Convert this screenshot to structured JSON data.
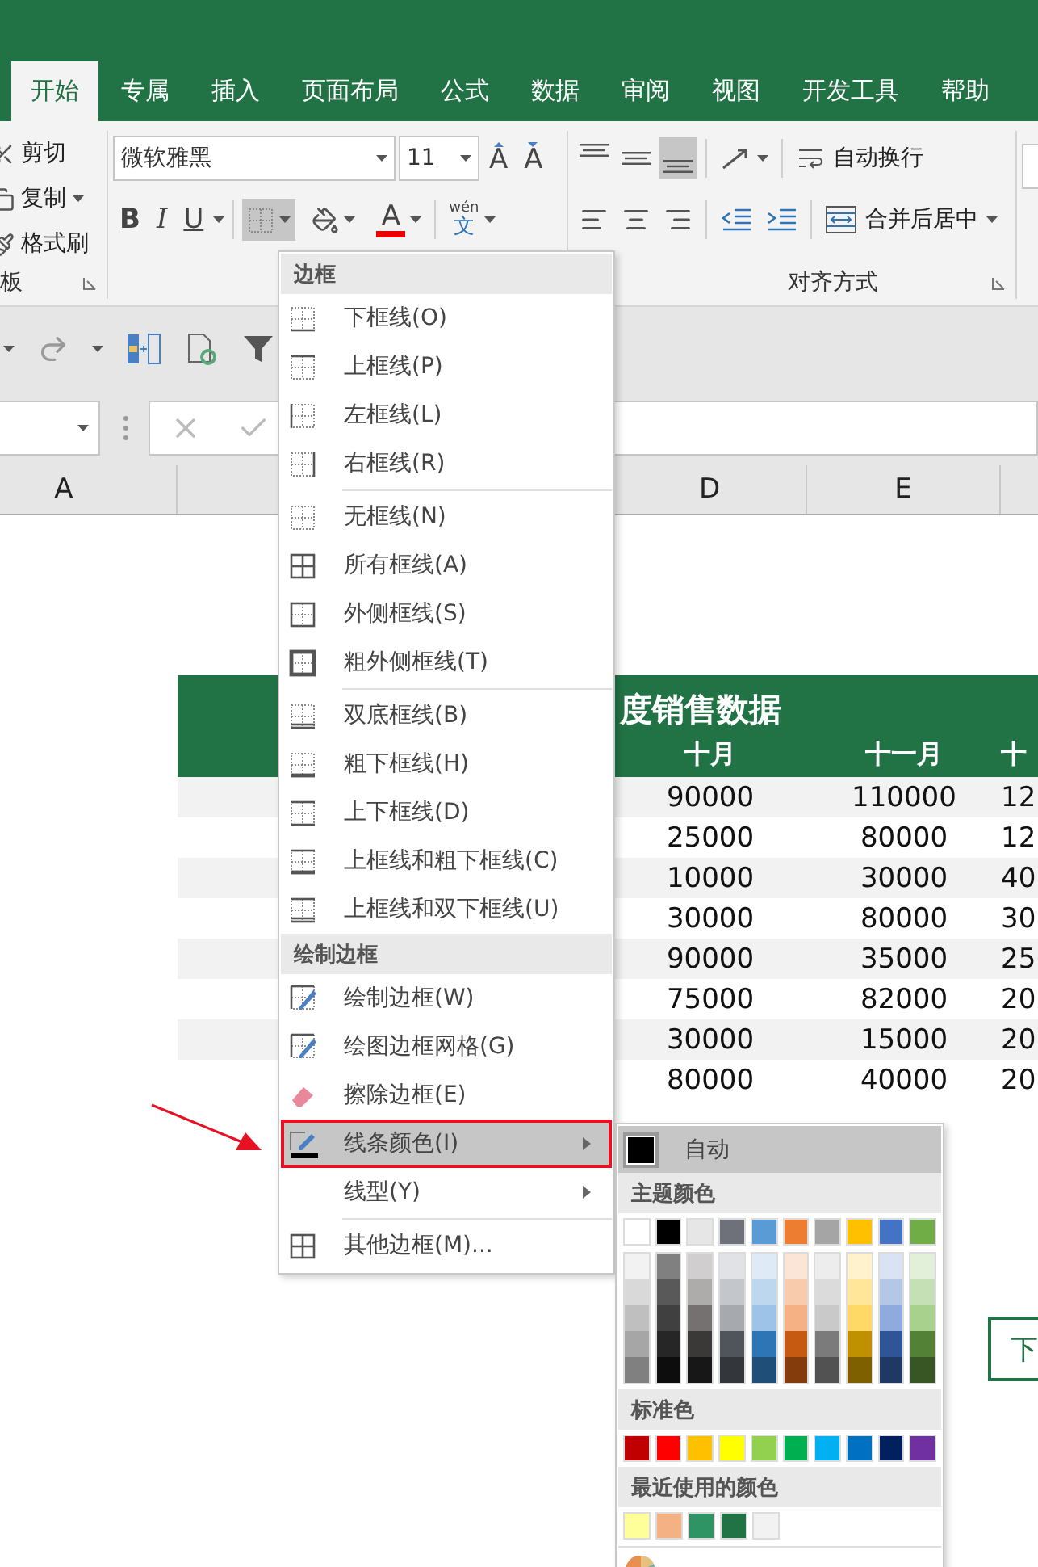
{
  "tabs": [
    {
      "label": "开始",
      "selected": true
    },
    {
      "label": "专属",
      "selected": false
    },
    {
      "label": "插入",
      "selected": false
    },
    {
      "label": "页面布局",
      "selected": false
    },
    {
      "label": "公式",
      "selected": false
    },
    {
      "label": "数据",
      "selected": false
    },
    {
      "label": "审阅",
      "selected": false
    },
    {
      "label": "视图",
      "selected": false
    },
    {
      "label": "开发工具",
      "selected": false
    },
    {
      "label": "帮助",
      "selected": false
    }
  ],
  "ribbon": {
    "clipboard": {
      "items": [
        {
          "label": "剪切",
          "has_menu": false
        },
        {
          "label": "复制",
          "has_menu": true
        },
        {
          "label": "格式刷",
          "has_menu": false
        }
      ],
      "group_label": "板"
    },
    "font": {
      "font_name": "微软雅黑",
      "font_size": "11",
      "grow_glyph": "A",
      "shrink_glyph": "A",
      "bold": "B",
      "italic": "I",
      "underline": "U",
      "border_pressed": true,
      "font_color_glyph": "A",
      "phonetic_top": "wén",
      "phonetic_bottom": "文"
    },
    "alignment": {
      "bottom_align_pressed": true,
      "wrap_text": "自动换行",
      "merge_center": "合并后居中",
      "group_label": "对齐方式"
    }
  },
  "column_headers": [
    {
      "label": "A"
    },
    {
      "label": "D"
    },
    {
      "label": "E"
    }
  ],
  "sheet": {
    "title": "度销售数据",
    "months": [
      "十月",
      "十一月",
      "十"
    ],
    "rows": [
      {
        "cells": [
          "90000",
          "110000",
          "12"
        ]
      },
      {
        "cells": [
          "25000",
          "80000",
          "12"
        ]
      },
      {
        "cells": [
          "10000",
          "30000",
          "40"
        ]
      },
      {
        "cells": [
          "30000",
          "80000",
          "30"
        ]
      },
      {
        "cells": [
          "90000",
          "35000",
          "25"
        ]
      },
      {
        "cells": [
          "75000",
          "82000",
          "20"
        ]
      },
      {
        "cells": [
          "30000",
          "15000",
          "20"
        ]
      },
      {
        "cells": [
          "80000",
          "40000",
          "20"
        ]
      }
    ]
  },
  "side_button": "下",
  "border_menu": {
    "sections": [
      {
        "heading": "边框",
        "groups": [
          [
            {
              "label": "下框线(O)",
              "selected": false,
              "highlighted": false,
              "submenu": false
            },
            {
              "label": "上框线(P)",
              "selected": false,
              "highlighted": false,
              "submenu": false
            },
            {
              "label": "左框线(L)",
              "selected": false,
              "highlighted": false,
              "submenu": false
            },
            {
              "label": "右框线(R)",
              "selected": false,
              "highlighted": false,
              "submenu": false
            }
          ],
          [
            {
              "label": "无框线(N)",
              "selected": false,
              "highlighted": false,
              "submenu": false
            },
            {
              "label": "所有框线(A)",
              "selected": false,
              "highlighted": false,
              "submenu": false
            },
            {
              "label": "外侧框线(S)",
              "selected": false,
              "highlighted": false,
              "submenu": false
            },
            {
              "label": "粗外侧框线(T)",
              "selected": false,
              "highlighted": false,
              "submenu": false
            }
          ],
          [
            {
              "label": "双底框线(B)",
              "selected": false,
              "highlighted": false,
              "submenu": false
            },
            {
              "label": "粗下框线(H)",
              "selected": false,
              "highlighted": false,
              "submenu": false
            },
            {
              "label": "上下框线(D)",
              "selected": false,
              "highlighted": false,
              "submenu": false
            },
            {
              "label": "上框线和粗下框线(C)",
              "selected": false,
              "highlighted": false,
              "submenu": false
            },
            {
              "label": "上框线和双下框线(U)",
              "selected": false,
              "highlighted": false,
              "submenu": false
            }
          ]
        ]
      },
      {
        "heading": "绘制边框",
        "groups": [
          [
            {
              "label": "绘制边框(W)",
              "selected": false,
              "highlighted": false,
              "submenu": false
            },
            {
              "label": "绘图边框网格(G)",
              "selected": false,
              "highlighted": false,
              "submenu": false
            },
            {
              "label": "擦除边框(E)",
              "selected": false,
              "highlighted": false,
              "submenu": false
            },
            {
              "label": "线条颜色(I)",
              "selected": true,
              "highlighted": true,
              "submenu": true
            },
            {
              "label": "线型(Y)",
              "selected": false,
              "highlighted": false,
              "submenu": true
            }
          ],
          [
            {
              "label": "其他边框(M)...",
              "selected": false,
              "highlighted": false,
              "submenu": false
            }
          ]
        ]
      }
    ]
  },
  "line_color_menu": {
    "automatic": {
      "label": "自动",
      "highlighted": true
    },
    "theme_heading": "主题颜色",
    "theme_colors": [
      {
        "color": "#ffffff"
      },
      {
        "color": "#000000"
      },
      {
        "color": "#e7e6e6"
      },
      {
        "color": "#6e7179"
      },
      {
        "color": "#5b9bd5"
      },
      {
        "color": "#ed7d31"
      },
      {
        "color": "#a5a5a5"
      },
      {
        "color": "#ffc000"
      },
      {
        "color": "#4472c4"
      },
      {
        "color": "#70ad47"
      }
    ],
    "theme_shades": [
      [
        {
          "color": "#f2f2f2"
        },
        {
          "color": "#d9d9d9"
        },
        {
          "color": "#bfbfbf"
        },
        {
          "color": "#a6a6a6"
        },
        {
          "color": "#808080"
        }
      ],
      [
        {
          "color": "#808080"
        },
        {
          "color": "#595959"
        },
        {
          "color": "#404040"
        },
        {
          "color": "#262626"
        },
        {
          "color": "#0d0d0d"
        }
      ],
      [
        {
          "color": "#d0cece"
        },
        {
          "color": "#aeabab"
        },
        {
          "color": "#767171"
        },
        {
          "color": "#3b3838"
        },
        {
          "color": "#171717"
        }
      ],
      [
        {
          "color": "#e0e2e5"
        },
        {
          "color": "#c3c6ca"
        },
        {
          "color": "#a6a9ad"
        },
        {
          "color": "#50555b"
        },
        {
          "color": "#33373c"
        }
      ],
      [
        {
          "color": "#deebf7"
        },
        {
          "color": "#bdd7ee"
        },
        {
          "color": "#9dc3e6"
        },
        {
          "color": "#2e75b6"
        },
        {
          "color": "#1f4e79"
        }
      ],
      [
        {
          "color": "#fbe5d6"
        },
        {
          "color": "#f8cbad"
        },
        {
          "color": "#f4b183"
        },
        {
          "color": "#c55a11"
        },
        {
          "color": "#843c0c"
        }
      ],
      [
        {
          "color": "#ededed"
        },
        {
          "color": "#dbdbdb"
        },
        {
          "color": "#c9c9c9"
        },
        {
          "color": "#7b7b7b"
        },
        {
          "color": "#525252"
        }
      ],
      [
        {
          "color": "#fff2cc"
        },
        {
          "color": "#ffe699"
        },
        {
          "color": "#ffd966"
        },
        {
          "color": "#bf9000"
        },
        {
          "color": "#7f6000"
        }
      ],
      [
        {
          "color": "#dae3f3"
        },
        {
          "color": "#b4c7e7"
        },
        {
          "color": "#8faadc"
        },
        {
          "color": "#2f5597"
        },
        {
          "color": "#203864"
        }
      ],
      [
        {
          "color": "#e2f0d9"
        },
        {
          "color": "#c5e0b4"
        },
        {
          "color": "#a9d18e"
        },
        {
          "color": "#538135"
        },
        {
          "color": "#375623"
        }
      ]
    ],
    "standard_heading": "标准色",
    "standard_colors": [
      {
        "color": "#c00000"
      },
      {
        "color": "#ff0000"
      },
      {
        "color": "#ffc000"
      },
      {
        "color": "#ffff00"
      },
      {
        "color": "#92d050"
      },
      {
        "color": "#00b050"
      },
      {
        "color": "#00b0f0"
      },
      {
        "color": "#0070c0"
      },
      {
        "color": "#002060"
      },
      {
        "color": "#7030a0"
      }
    ],
    "recent_heading": "最近使用的颜色",
    "recent_colors": [
      {
        "color": "#ffff99"
      },
      {
        "color": "#f4b183"
      },
      {
        "color": "#2e9464"
      },
      {
        "color": "#217346"
      },
      {
        "color": "#f2f2f2"
      }
    ]
  }
}
